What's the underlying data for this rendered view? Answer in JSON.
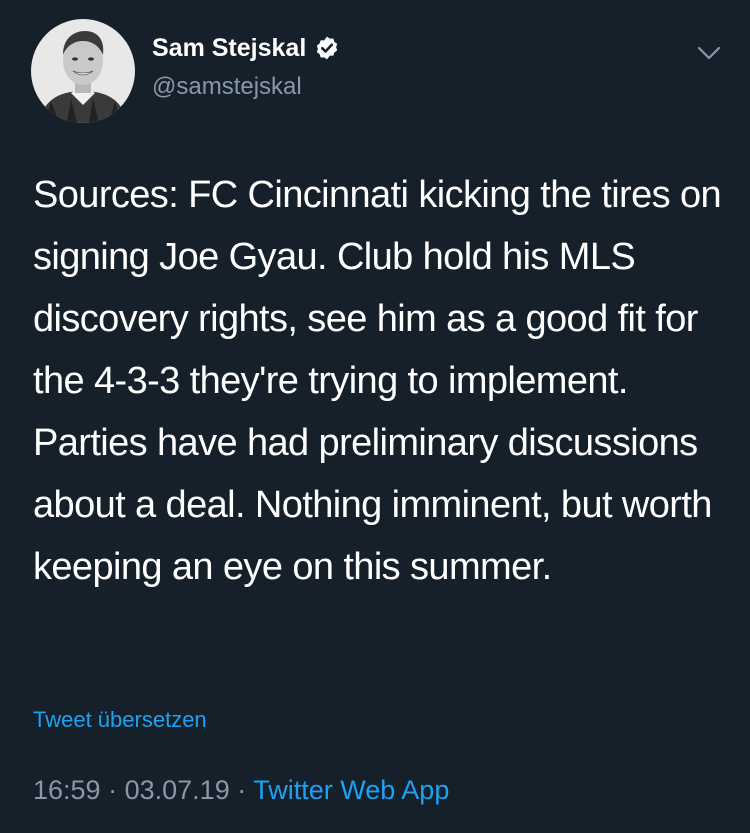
{
  "author": {
    "display_name": "Sam Stejskal",
    "handle": "@samstejskal",
    "verified": true
  },
  "tweet": {
    "text": "Sources: FC Cincinnati kicking the tires on signing Joe Gyau. Club hold his MLS discovery rights, see him as a good fit for the 4-3-3 they're trying to implement. Parties have had preliminary discussions about a deal. Nothing imminent, but worth keeping an eye on this summer.",
    "translate_label": "Tweet übersetzen"
  },
  "meta": {
    "time": "16:59",
    "separator": "·",
    "date": "03.07.19",
    "source": "Twitter Web App"
  },
  "colors": {
    "background": "#15202b",
    "text_primary": "#ffffff",
    "text_secondary": "#8899a6",
    "accent": "#1da1f2"
  },
  "icons": {
    "verified": "verified-badge-icon",
    "more": "chevron-down-icon"
  }
}
